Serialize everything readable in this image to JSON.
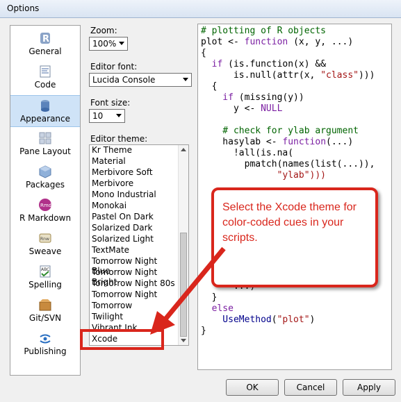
{
  "window": {
    "title": "Options"
  },
  "sidebar": {
    "items": [
      {
        "label": "General",
        "icon": "r-logo-icon"
      },
      {
        "label": "Code",
        "icon": "code-icon"
      },
      {
        "label": "Appearance",
        "icon": "appearance-icon",
        "selected": true
      },
      {
        "label": "Pane Layout",
        "icon": "pane-layout-icon"
      },
      {
        "label": "Packages",
        "icon": "packages-icon"
      },
      {
        "label": "R Markdown",
        "icon": "rmd-icon"
      },
      {
        "label": "Sweave",
        "icon": "sweave-icon"
      },
      {
        "label": "Spelling",
        "icon": "spelling-icon"
      },
      {
        "label": "Git/SVN",
        "icon": "git-icon"
      },
      {
        "label": "Publishing",
        "icon": "publishing-icon"
      }
    ]
  },
  "appearance": {
    "zoom_label": "Zoom:",
    "zoom_value": "100%",
    "font_label": "Editor font:",
    "font_value": "Lucida Console",
    "size_label": "Font size:",
    "size_value": "10",
    "theme_label": "Editor theme:",
    "themes": [
      "Kr Theme",
      "Material",
      "Merbivore Soft",
      "Merbivore",
      "Mono Industrial",
      "Monokai",
      "Pastel On Dark",
      "Solarized Dark",
      "Solarized Light",
      "TextMate",
      "Tomorrow Night Blue",
      "Tomorrow Night Bright",
      "Tomorrow Night 80s",
      "Tomorrow Night",
      "Tomorrow",
      "Twilight",
      "Vibrant Ink",
      "Xcode"
    ],
    "selected_theme": "Xcode"
  },
  "code_preview": {
    "lines": [
      "# plotting of R objects",
      "plot <- function (x, y, ...)",
      "{",
      "  if (is.function(x) &&",
      "      is.null(attr(x, \"class\")))",
      "  {",
      "    if (missing(y))",
      "      y <- NULL",
      "",
      "    # check for ylab argument",
      "    hasylab <- function(...)",
      "      !all(is.na(",
      "        pmatch(names(list(...)),",
      "              \"ylab\")))",
      "",
      "    if (hasylab(...))",
      "",
      "",
      "",
      "",
      "",
      "",
      "",
      "      ...)",
      "  }",
      "  else",
      "    UseMethod(\"plot\")",
      "}"
    ]
  },
  "buttons": {
    "ok": "OK",
    "cancel": "Cancel",
    "apply": "Apply"
  },
  "annotation": {
    "text": "Select the Xcode theme for color-coded cues in your scripts.",
    "color": "#d9261c"
  }
}
